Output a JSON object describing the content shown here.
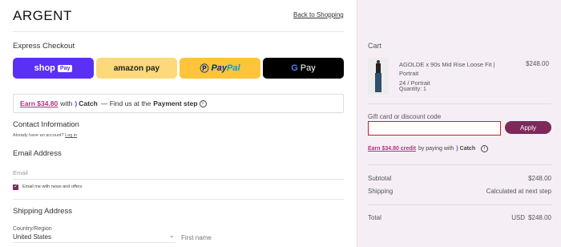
{
  "header": {
    "logo": "ARGENT",
    "back_link": "Back to Shopping"
  },
  "express": {
    "title": "Express Checkout",
    "shop_pay": "shop",
    "shop_pay_badge": "Pay",
    "amazon_pay": "amazon pay",
    "paypal_a": "Pay",
    "paypal_b": "Pal",
    "gpay_g": "G",
    "gpay_text": "Pay"
  },
  "catch_banner": {
    "earn": "Earn $34.80",
    "with": "with",
    "brand": "Catch",
    "text": "— Find us at the",
    "bold": "Payment step"
  },
  "contact": {
    "title": "Contact Information",
    "have_account": "Already have an account?",
    "login": "Log in",
    "email_heading": "Email Address",
    "email_placeholder": "Email",
    "newsletter_label": "Email me with news and offers"
  },
  "shipping": {
    "title": "Shipping Address",
    "country_label": "Country/Region",
    "country_value": "United States",
    "first_name_placeholder": "First name"
  },
  "cart": {
    "title": "Cart",
    "item": {
      "name": "AGOLDE x 90s Mid Rise Loose Fit | Portrait",
      "variant": "24 / Portrait",
      "quantity": "Quantity: 1",
      "price": "$248.00"
    },
    "gift_label": "Gift card or discount code",
    "gift_value": "",
    "apply": "Apply",
    "credit_earn": "Earn $34.80 credit",
    "credit_text": "by paying with",
    "credit_brand": "Catch",
    "subtotal_label": "Subtotal",
    "subtotal_value": "$248.00",
    "shipping_label": "Shipping",
    "shipping_value": "Calculated at next step",
    "total_label": "Total",
    "total_currency": "USD",
    "total_value": "$248.00"
  },
  "colors": {
    "accent": "#7b2a5a",
    "shop_pay": "#5a31f4",
    "amazon": "#fed97a",
    "paypal": "#ffc439",
    "error": "#d71920",
    "sidebar_bg": "#f5eff5"
  }
}
